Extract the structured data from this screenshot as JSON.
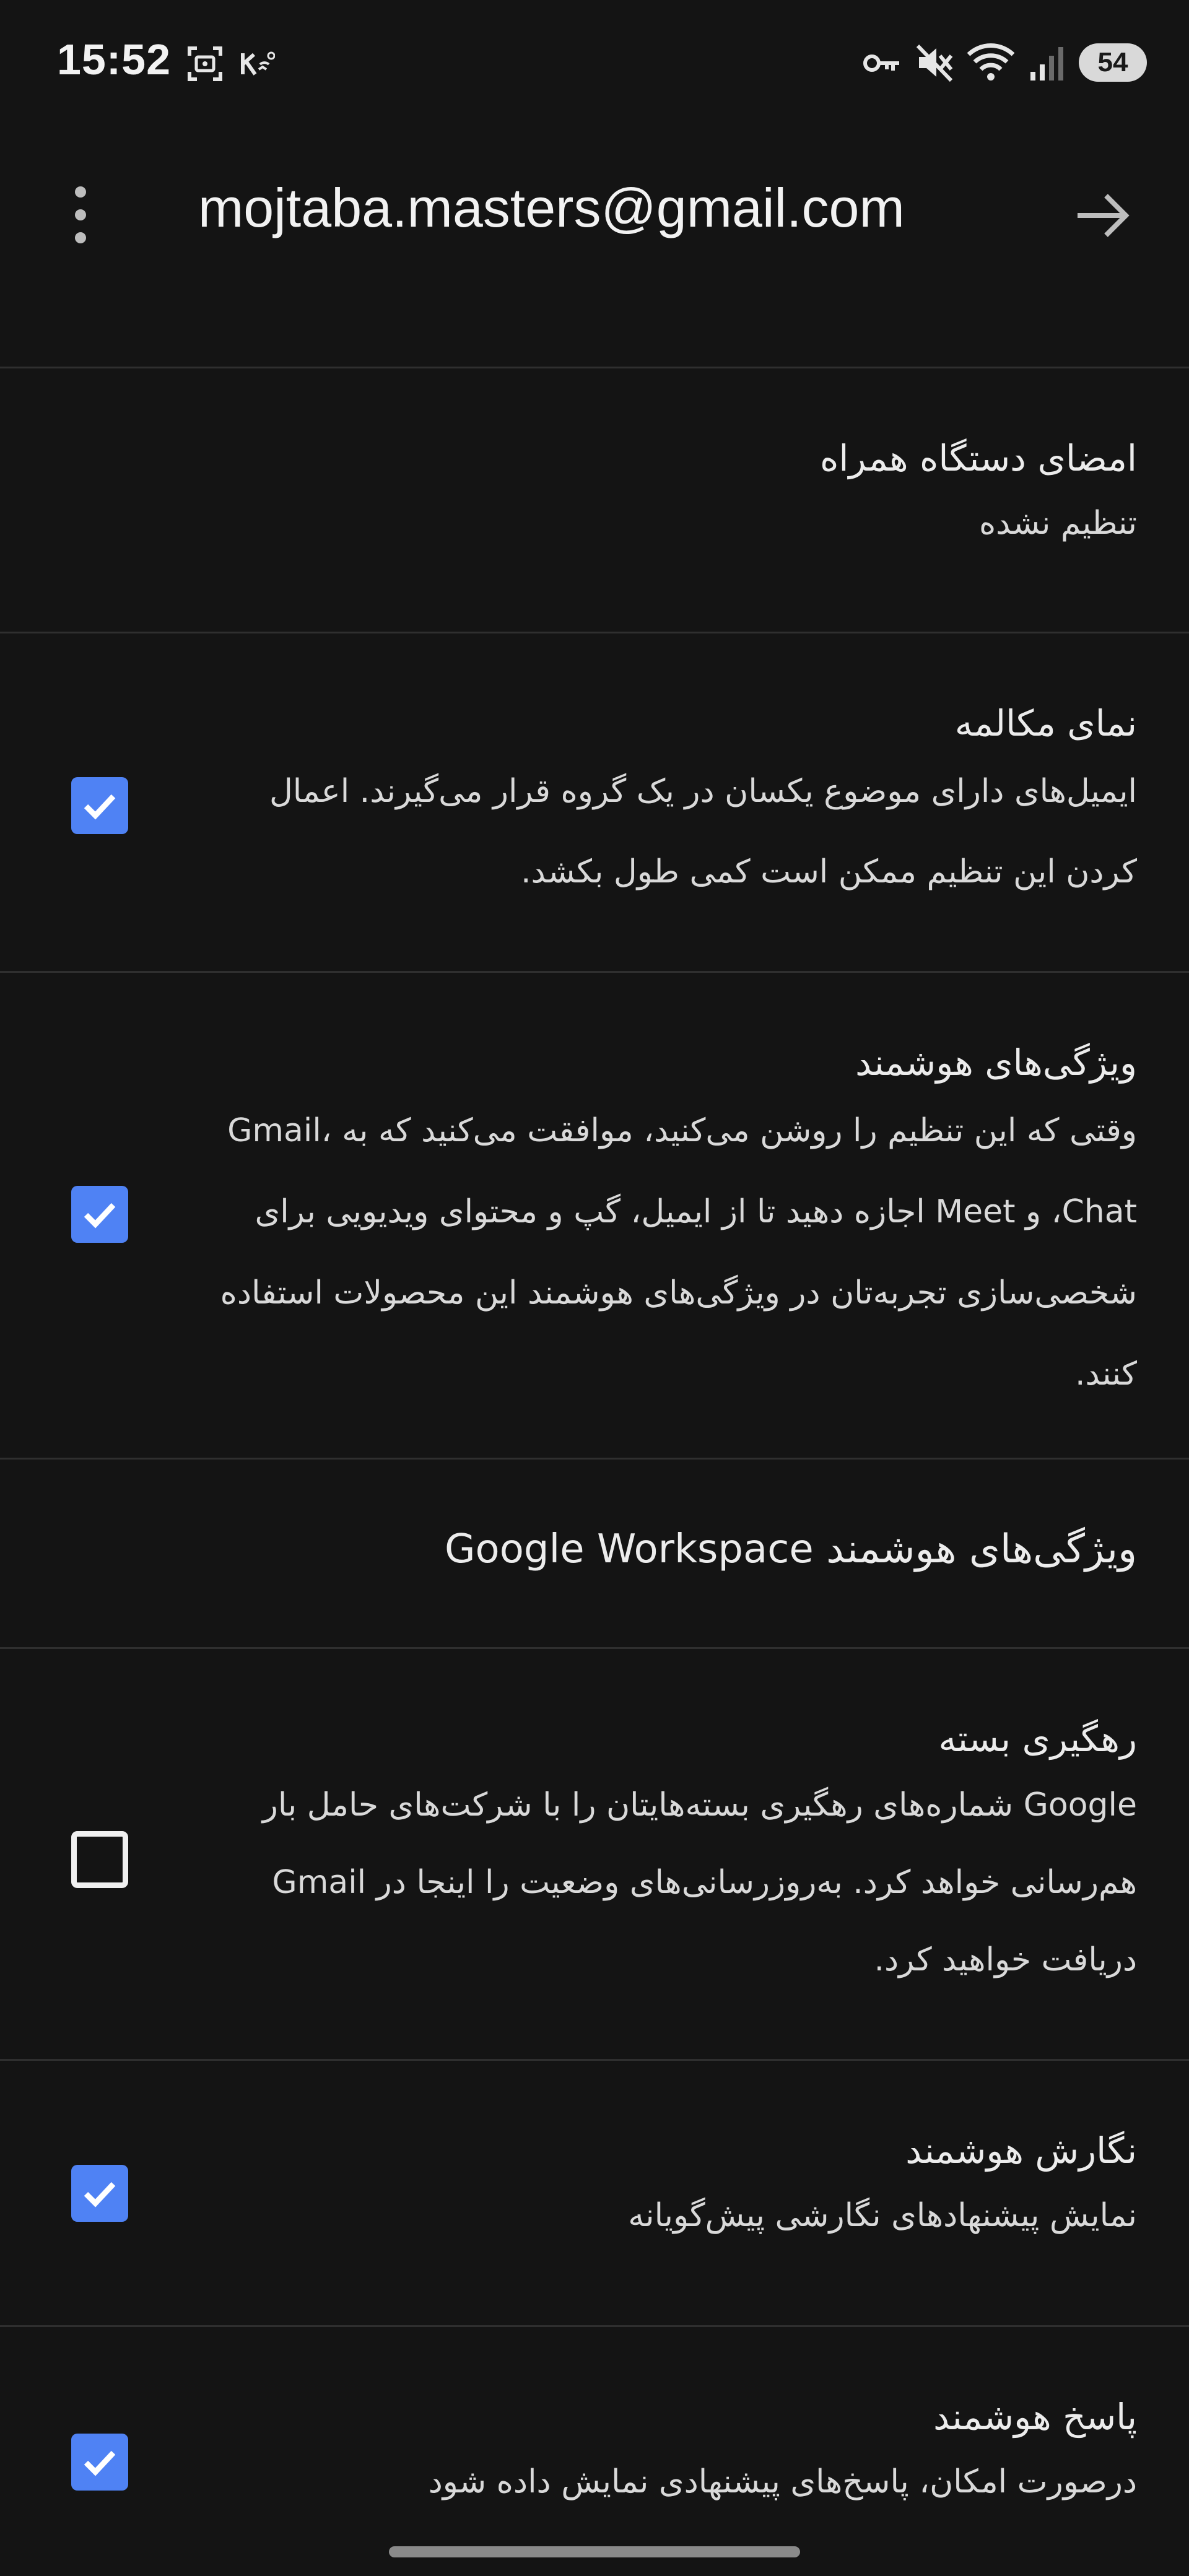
{
  "status_bar": {
    "time": "15:52",
    "battery": "54",
    "icons": [
      "screenshot-icon",
      "vowifi-icon",
      "vpn-key-icon",
      "mute-icon",
      "wifi-icon",
      "signal-icon"
    ]
  },
  "header": {
    "account_email": "mojtaba.masters@gmail.com",
    "menu_icon": "more-vert-icon",
    "forward_icon": "arrow-forward-icon"
  },
  "settings": {
    "mobile_signature": {
      "title": "امضای دستگاه همراه",
      "subtitle": "تنظیم نشده"
    },
    "conversation_view": {
      "title": "نمای مکالمه",
      "description": "ایمیل‌های دارای موضوع یکسان در یک گروه قرار می‌گیرند. اعمال کردن این تنظیم ممکن است کمی طول بکشد.",
      "checked": true
    },
    "smart_features": {
      "title": "ویژگی‌های هوشمند",
      "description": "وقتی که این تنظیم را روشن می‌کنید، موافقت می‌کنید که به Gmail، Chat، و Meet اجازه دهید تا از ایمیل، گپ و محتوای ویدیویی برای شخصی‌سازی تجربه‌تان در ویژگی‌های هوشمند این محصولات استفاده کنند.",
      "checked": true
    },
    "workspace_smart_features": {
      "title": "ویژگی‌های هوشمند Google Workspace"
    },
    "package_tracking": {
      "title": "رهگیری بسته",
      "description": "Google شماره‌های رهگیری بسته‌هایتان را با شرکت‌های حامل بار هم‌رسانی خواهد کرد. به‌روزرسانی‌های وضعیت را اینجا در Gmail دریافت خواهید کرد.",
      "checked": false
    },
    "smart_compose": {
      "title": "نگارش هوشمند",
      "description": "نمایش پیشنهادهای نگارشی پیش‌گویانه",
      "checked": true
    },
    "smart_reply": {
      "title": "پاسخ هوشمند",
      "description": "درصورت امکان، پاسخ‌های پیشنهادی نمایش داده شود",
      "checked": true
    }
  },
  "colors": {
    "background": "#141414",
    "checkbox_on": "#4f82f4",
    "divider": "#2f2f2f",
    "text": "#ececec"
  }
}
